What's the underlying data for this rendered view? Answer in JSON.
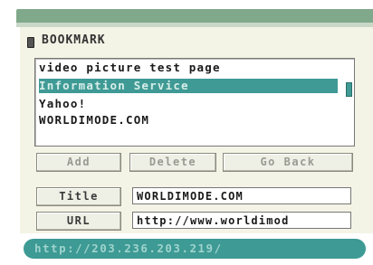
{
  "header": {
    "title": "BOOKMARK",
    "icon": "bookmark-icon"
  },
  "bookmarks": [
    "video picture test page",
    "Information Service",
    "Yahoo!",
    "WORLDIMODE.COM"
  ],
  "selected_index": 1,
  "buttons": {
    "add": "Add",
    "delete": "Delete",
    "go_back": "Go Back"
  },
  "fields": {
    "title_label": "Title",
    "title_value": "WORLDIMODE.COM",
    "url_label": "URL",
    "url_value": "http://www.worldimod"
  },
  "status": {
    "url": "http://203.236.203.219/"
  },
  "colors": {
    "accent": "#3f9a95",
    "top_bar": "#7fa98a",
    "panel": "#f3f4e6"
  }
}
